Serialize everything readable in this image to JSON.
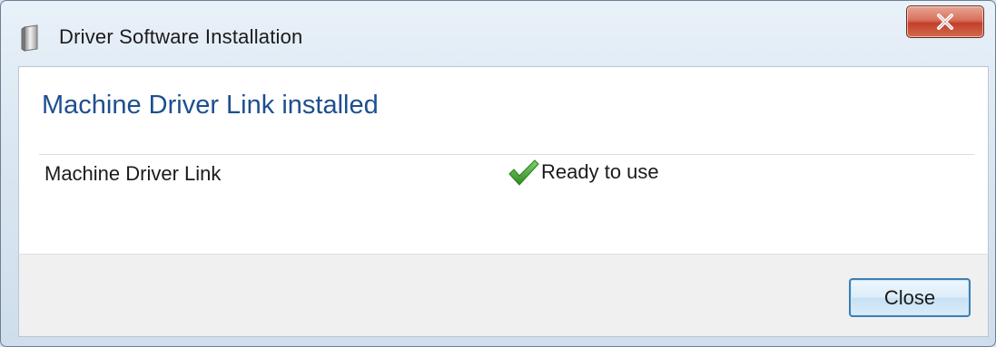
{
  "window": {
    "title": "Driver Software Installation",
    "title_icon": "device-icon",
    "close_icon": "close-icon"
  },
  "content": {
    "heading": "Machine Driver Link installed",
    "devices": [
      {
        "name": "Machine Driver Link",
        "status": "Ready to use",
        "status_icon": "checkmark-icon"
      }
    ]
  },
  "footer": {
    "close_label": "Close"
  },
  "colors": {
    "heading": "#1e4f8f",
    "check": "#3a9b2c",
    "close_x": "#c2402a",
    "button_border": "#3c7fb1"
  }
}
